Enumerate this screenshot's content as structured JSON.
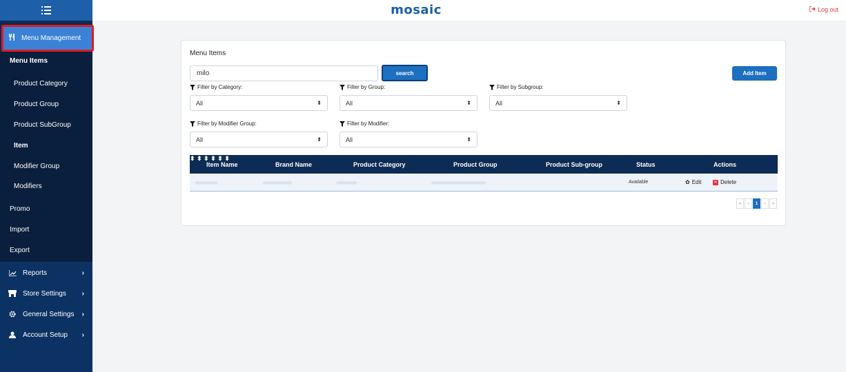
{
  "header": {
    "brand": "mosaic",
    "logout_label": "Log out"
  },
  "sidebar": {
    "active_section": "Menu Management",
    "menu_items_heading": "Menu Items",
    "sub_items": [
      {
        "label": "Product Category"
      },
      {
        "label": "Product Group"
      },
      {
        "label": "Product SubGroup"
      },
      {
        "label": "Item"
      },
      {
        "label": "Modifier Group"
      },
      {
        "label": "Modifiers"
      }
    ],
    "top_items": [
      {
        "label": "Promo"
      },
      {
        "label": "Import"
      },
      {
        "label": "Export"
      }
    ],
    "sections": [
      {
        "label": "Reports",
        "icon": "chart-icon"
      },
      {
        "label": "Store Settings",
        "icon": "store-icon"
      },
      {
        "label": "General Settings",
        "icon": "gear-icon"
      },
      {
        "label": "Account Setup",
        "icon": "user-icon"
      }
    ]
  },
  "main": {
    "card_title": "Menu Items",
    "search": {
      "value": "milo",
      "button_label": "search"
    },
    "add_button_label": "Add Item",
    "filters": [
      {
        "label": "Filter by Category:",
        "value": "All"
      },
      {
        "label": "Filter by Group:",
        "value": "All"
      },
      {
        "label": "Filter by Subgroup:",
        "value": "All"
      },
      {
        "label": "Filter by Modifier Group:",
        "value": "All"
      },
      {
        "label": "Filter by Modifier:",
        "value": "All"
      }
    ],
    "table": {
      "columns": [
        "Item Name",
        "Brand Name",
        "Product Category",
        "Product Group",
        "Product Sub-group",
        "Status",
        "Actions"
      ],
      "rows": [
        {
          "status": "Available",
          "edit_label": "Edit",
          "delete_label": "Delete"
        }
      ]
    },
    "pagination": {
      "first": "«",
      "prev": "‹",
      "current": "1",
      "next": "›",
      "last": "»"
    }
  },
  "colors": {
    "sidebar": "#0d2c55",
    "accent": "#1d6fc0",
    "highlight_border": "#e01a22",
    "danger": "#e8333a"
  }
}
